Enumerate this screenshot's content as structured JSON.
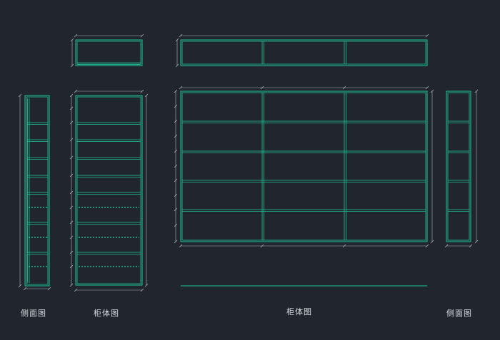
{
  "labels": {
    "side_left": "侧面图",
    "body_left": "柜体图",
    "body_main": "柜体图",
    "side_right": "侧面图"
  },
  "colors": {
    "background": "#21262e",
    "cabinet_line": "#1fc59a",
    "dimension_line": "#a9b1bc",
    "dashed_line": "#27d8a8"
  }
}
